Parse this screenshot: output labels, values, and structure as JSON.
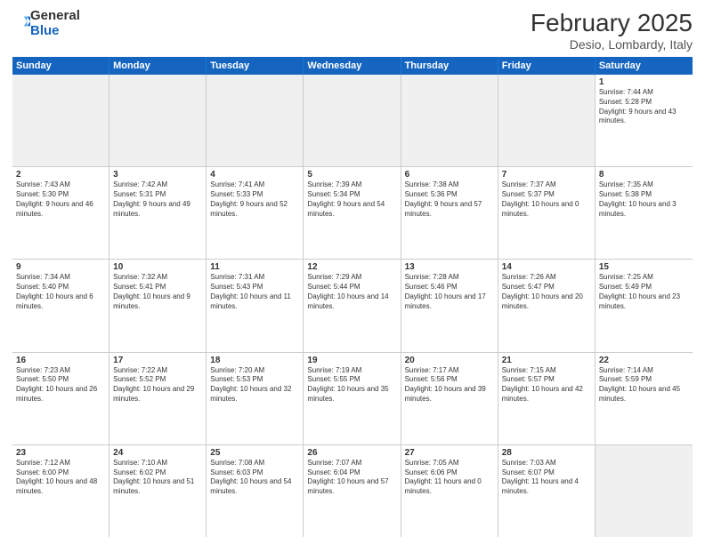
{
  "header": {
    "logo_general": "General",
    "logo_blue": "Blue",
    "month_title": "February 2025",
    "location": "Desio, Lombardy, Italy"
  },
  "weekdays": [
    "Sunday",
    "Monday",
    "Tuesday",
    "Wednesday",
    "Thursday",
    "Friday",
    "Saturday"
  ],
  "rows": [
    [
      {
        "day": "",
        "text": "",
        "shaded": true
      },
      {
        "day": "",
        "text": "",
        "shaded": true
      },
      {
        "day": "",
        "text": "",
        "shaded": true
      },
      {
        "day": "",
        "text": "",
        "shaded": true
      },
      {
        "day": "",
        "text": "",
        "shaded": true
      },
      {
        "day": "",
        "text": "",
        "shaded": true
      },
      {
        "day": "1",
        "text": "Sunrise: 7:44 AM\nSunset: 5:28 PM\nDaylight: 9 hours and 43 minutes."
      }
    ],
    [
      {
        "day": "2",
        "text": "Sunrise: 7:43 AM\nSunset: 5:30 PM\nDaylight: 9 hours and 46 minutes."
      },
      {
        "day": "3",
        "text": "Sunrise: 7:42 AM\nSunset: 5:31 PM\nDaylight: 9 hours and 49 minutes."
      },
      {
        "day": "4",
        "text": "Sunrise: 7:41 AM\nSunset: 5:33 PM\nDaylight: 9 hours and 52 minutes."
      },
      {
        "day": "5",
        "text": "Sunrise: 7:39 AM\nSunset: 5:34 PM\nDaylight: 9 hours and 54 minutes."
      },
      {
        "day": "6",
        "text": "Sunrise: 7:38 AM\nSunset: 5:36 PM\nDaylight: 9 hours and 57 minutes."
      },
      {
        "day": "7",
        "text": "Sunrise: 7:37 AM\nSunset: 5:37 PM\nDaylight: 10 hours and 0 minutes."
      },
      {
        "day": "8",
        "text": "Sunrise: 7:35 AM\nSunset: 5:38 PM\nDaylight: 10 hours and 3 minutes."
      }
    ],
    [
      {
        "day": "9",
        "text": "Sunrise: 7:34 AM\nSunset: 5:40 PM\nDaylight: 10 hours and 6 minutes."
      },
      {
        "day": "10",
        "text": "Sunrise: 7:32 AM\nSunset: 5:41 PM\nDaylight: 10 hours and 9 minutes."
      },
      {
        "day": "11",
        "text": "Sunrise: 7:31 AM\nSunset: 5:43 PM\nDaylight: 10 hours and 11 minutes."
      },
      {
        "day": "12",
        "text": "Sunrise: 7:29 AM\nSunset: 5:44 PM\nDaylight: 10 hours and 14 minutes."
      },
      {
        "day": "13",
        "text": "Sunrise: 7:28 AM\nSunset: 5:46 PM\nDaylight: 10 hours and 17 minutes."
      },
      {
        "day": "14",
        "text": "Sunrise: 7:26 AM\nSunset: 5:47 PM\nDaylight: 10 hours and 20 minutes."
      },
      {
        "day": "15",
        "text": "Sunrise: 7:25 AM\nSunset: 5:49 PM\nDaylight: 10 hours and 23 minutes."
      }
    ],
    [
      {
        "day": "16",
        "text": "Sunrise: 7:23 AM\nSunset: 5:50 PM\nDaylight: 10 hours and 26 minutes."
      },
      {
        "day": "17",
        "text": "Sunrise: 7:22 AM\nSunset: 5:52 PM\nDaylight: 10 hours and 29 minutes."
      },
      {
        "day": "18",
        "text": "Sunrise: 7:20 AM\nSunset: 5:53 PM\nDaylight: 10 hours and 32 minutes."
      },
      {
        "day": "19",
        "text": "Sunrise: 7:19 AM\nSunset: 5:55 PM\nDaylight: 10 hours and 35 minutes."
      },
      {
        "day": "20",
        "text": "Sunrise: 7:17 AM\nSunset: 5:56 PM\nDaylight: 10 hours and 39 minutes."
      },
      {
        "day": "21",
        "text": "Sunrise: 7:15 AM\nSunset: 5:57 PM\nDaylight: 10 hours and 42 minutes."
      },
      {
        "day": "22",
        "text": "Sunrise: 7:14 AM\nSunset: 5:59 PM\nDaylight: 10 hours and 45 minutes."
      }
    ],
    [
      {
        "day": "23",
        "text": "Sunrise: 7:12 AM\nSunset: 6:00 PM\nDaylight: 10 hours and 48 minutes."
      },
      {
        "day": "24",
        "text": "Sunrise: 7:10 AM\nSunset: 6:02 PM\nDaylight: 10 hours and 51 minutes."
      },
      {
        "day": "25",
        "text": "Sunrise: 7:08 AM\nSunset: 6:03 PM\nDaylight: 10 hours and 54 minutes."
      },
      {
        "day": "26",
        "text": "Sunrise: 7:07 AM\nSunset: 6:04 PM\nDaylight: 10 hours and 57 minutes."
      },
      {
        "day": "27",
        "text": "Sunrise: 7:05 AM\nSunset: 6:06 PM\nDaylight: 11 hours and 0 minutes."
      },
      {
        "day": "28",
        "text": "Sunrise: 7:03 AM\nSunset: 6:07 PM\nDaylight: 11 hours and 4 minutes."
      },
      {
        "day": "",
        "text": "",
        "shaded": true
      }
    ]
  ]
}
